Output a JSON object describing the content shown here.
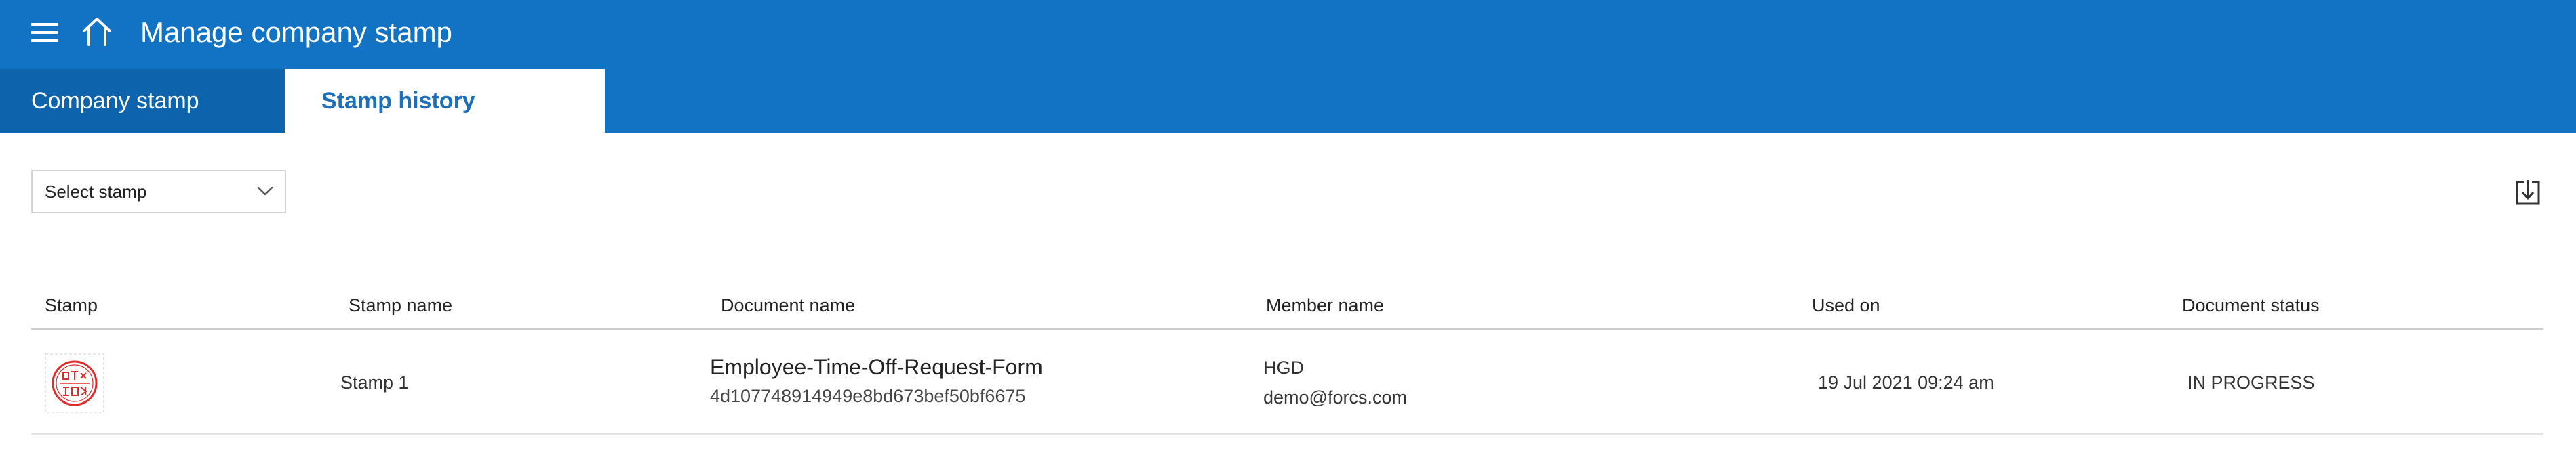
{
  "header": {
    "title": "Manage company stamp",
    "menu_icon": "hamburger-menu-icon",
    "home_icon": "home-icon",
    "background_color": "#1273c4"
  },
  "tabs": [
    {
      "label": "Company stamp",
      "active": false
    },
    {
      "label": "Stamp history",
      "active": true
    }
  ],
  "filters": {
    "stamp_select": {
      "value": "Select stamp",
      "icon": "chevron-down-icon"
    }
  },
  "toolbar": {
    "download_icon": "download-icon"
  },
  "table": {
    "columns": [
      "Stamp",
      "Stamp name",
      "Document name",
      "Member name",
      "Used on",
      "Document status"
    ],
    "rows": [
      {
        "stamp_image": "company-stamp-seal",
        "stamp_name": "Stamp 1",
        "document_name": "Employee-Time-Off-Request-Form",
        "document_id": "4d107748914949e8bd673bef50bf6675",
        "member_name": "HGD",
        "member_email": "demo@forcs.com",
        "used_on": "19 Jul 2021 09:24 am",
        "document_status": "IN PROGRESS"
      }
    ]
  },
  "colors": {
    "accent": "#1273c4",
    "tab_inactive": "#0e63ad",
    "tab_active_text": "#1b6fbc",
    "stamp_red": "#e02b2b"
  }
}
